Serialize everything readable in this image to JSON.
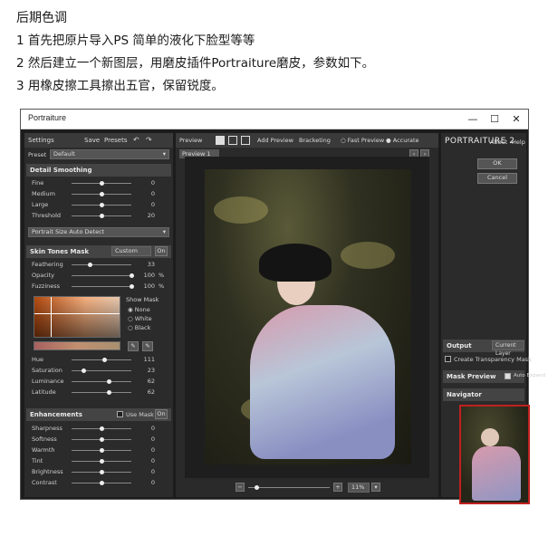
{
  "intro": {
    "title": "后期色调",
    "step1": "1 首先把原片导入PS  简单的液化下脸型等等",
    "step2": "2 然后建立一个新图层，用磨皮插件Portraiture磨皮，参数如下。",
    "step3": "3 用橡皮擦工具擦出五官，保留锐度。"
  },
  "window": {
    "title": "Portraiture",
    "minimize": "—",
    "maximize": "☐",
    "close": "✕"
  },
  "left": {
    "settings_label": "Settings",
    "save_label": "Save",
    "presets_label": "Presets",
    "preset_label": "Preset",
    "preset_value": "Default",
    "detail": {
      "header": "Detail Smoothing",
      "rows": [
        {
          "label": "Fine",
          "value": "0",
          "pos": 0.5
        },
        {
          "label": "Medium",
          "value": "0",
          "pos": 0.5
        },
        {
          "label": "Large",
          "value": "0",
          "pos": 0.5
        },
        {
          "label": "Threshold",
          "value": "20",
          "pos": 0.5
        }
      ],
      "portrait_size": "Portrait Size Auto Detect"
    },
    "mask": {
      "header": "Skin Tones Mask",
      "mode": "Custom",
      "on": "On",
      "rows": [
        {
          "label": "Feathering",
          "value": "33",
          "unit": "",
          "pos": 0.3
        },
        {
          "label": "Opacity",
          "value": "100",
          "unit": "%",
          "pos": 1.0
        },
        {
          "label": "Fuzziness",
          "value": "100",
          "unit": "%",
          "pos": 1.0
        }
      ],
      "show_mask": "Show Mask",
      "opt_none": "None",
      "opt_white": "White",
      "opt_black": "Black",
      "sliders": [
        {
          "label": "Hue",
          "value": "111",
          "pos": 0.55
        },
        {
          "label": "Saturation",
          "value": "23",
          "pos": 0.2
        },
        {
          "label": "Luminance",
          "value": "62",
          "pos": 0.62
        },
        {
          "label": "Latitude",
          "value": "62",
          "pos": 0.62
        }
      ]
    },
    "enh": {
      "header": "Enhancements",
      "use_mask": "Use Mask",
      "on": "On",
      "rows": [
        {
          "label": "Sharpness",
          "value": "0",
          "pos": 0.5
        },
        {
          "label": "Softness",
          "value": "0",
          "pos": 0.5
        },
        {
          "label": "Warmth",
          "value": "0",
          "pos": 0.5
        },
        {
          "label": "Tint",
          "value": "0",
          "pos": 0.5
        },
        {
          "label": "Brightness",
          "value": "0",
          "pos": 0.5
        },
        {
          "label": "Contrast",
          "value": "0",
          "pos": 0.5
        }
      ]
    }
  },
  "center": {
    "preview_label": "Preview",
    "add_preview": "Add Preview",
    "bracketing": "Bracketing",
    "fast_preview": "Fast Preview",
    "accurate": "Accurate",
    "tab": "Preview 1",
    "zoom": "11%",
    "zoom_pos": 0.1
  },
  "right": {
    "brand": "PORTRAITURE 2",
    "about": "About",
    "help": "Help",
    "ok": "OK",
    "cancel": "Cancel",
    "output_label": "Output",
    "output_value": "Current Layer",
    "transparency": "Create Transparency Mask",
    "mask_preview": "Mask Preview",
    "auto_expand": "Auto Expand",
    "navigator": "Navigator"
  }
}
